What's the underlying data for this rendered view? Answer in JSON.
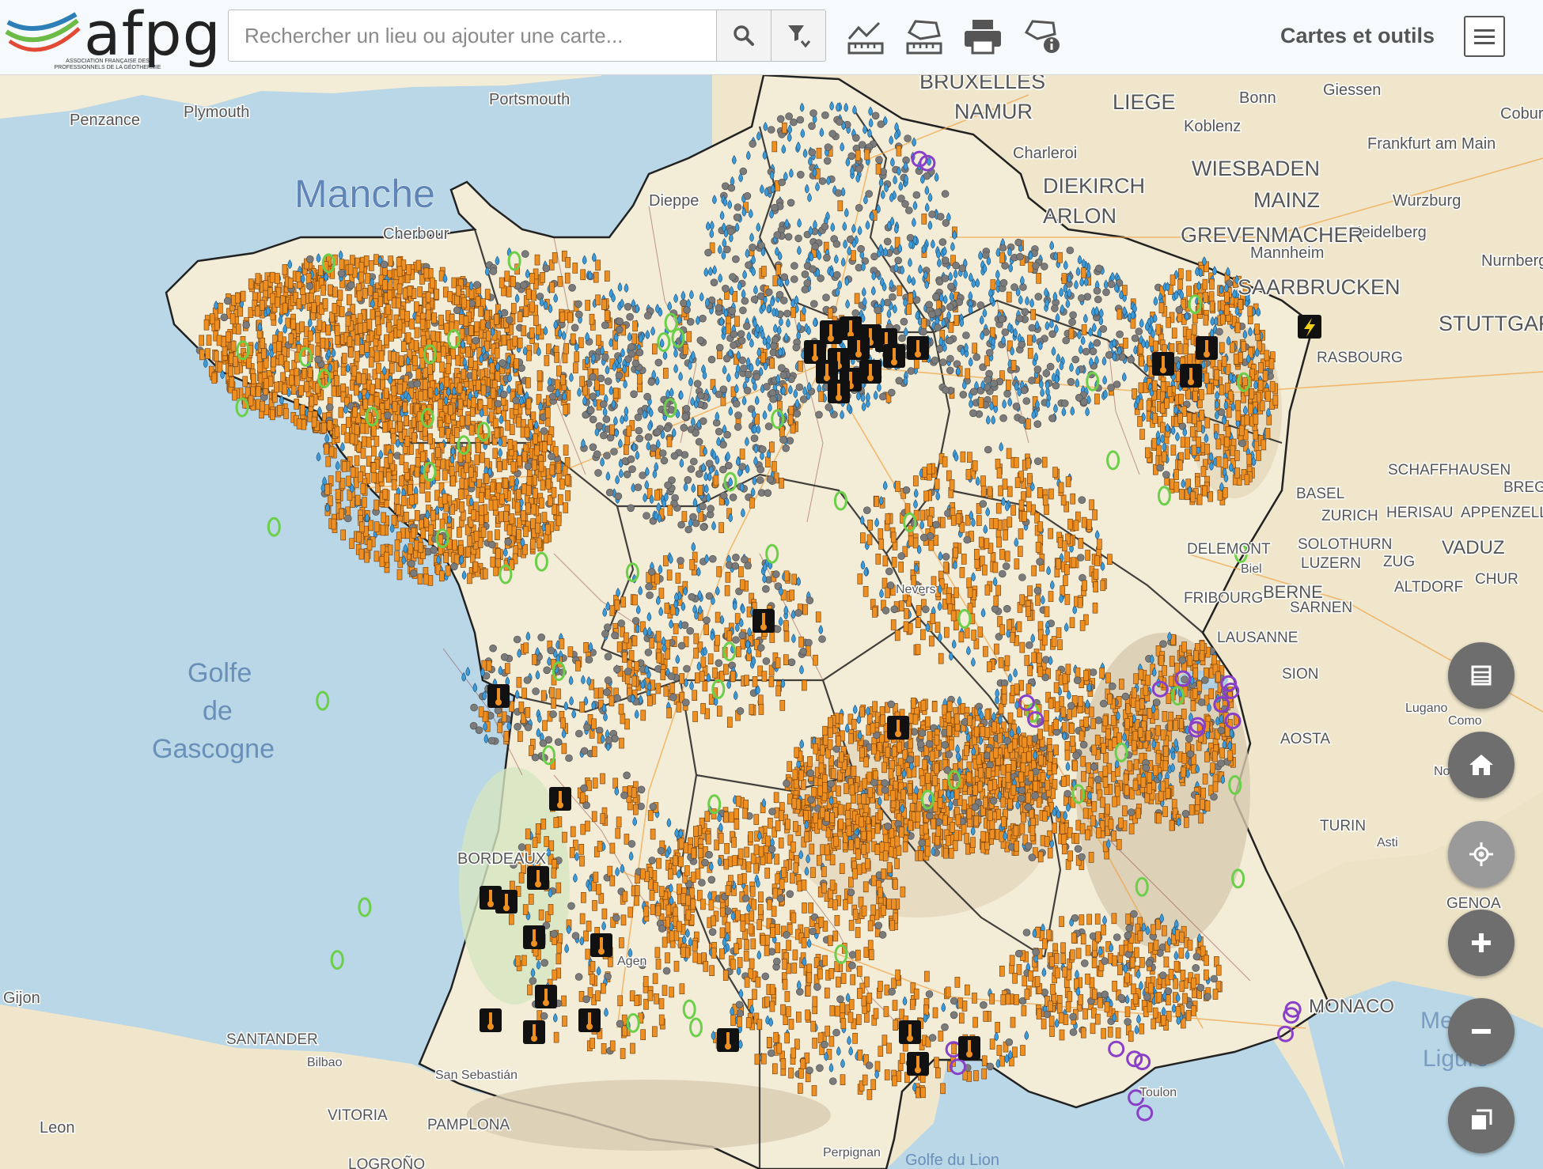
{
  "header": {
    "logo_text": "afpg",
    "logo_subtitle": "ASSOCIATION FRANÇAISE DES PROFESSIONNELS DE LA GÉOTHERMIE",
    "search_placeholder": "Rechercher un lieu ou ajouter une carte...",
    "tools_label": "Cartes et outils"
  },
  "icons": [
    "search-icon",
    "filter-icon",
    "measure-line-icon",
    "measure-area-icon",
    "print-icon",
    "info-icon",
    "menu-icon",
    "table-icon",
    "home-icon",
    "locate-icon",
    "zoom-in-icon",
    "zoom-out-icon",
    "background-layers-icon"
  ],
  "map": {
    "sea_labels": {
      "manche": "Manche",
      "golfe1": "Golfe",
      "golfe2": "de",
      "golfe3": "Gascogne",
      "lion": "Golfe du Lion",
      "ligure1": "Mer",
      "ligure2": "Ligure"
    },
    "cities": {
      "penzance": "Penzance",
      "plymouth": "Plymouth",
      "portsmouth": "Portsmouth",
      "bruxelles": "BRUXELLES",
      "namur": "NAMUR",
      "liege": "LIEGE",
      "bonn": "Bonn",
      "giessen": "Giessen",
      "koblenz": "Koblenz",
      "charleroi": "Charleroi",
      "frankfurt": "Frankfurt am Main",
      "coburg": "Coburg",
      "wiesbaden": "WIESBADEN",
      "mainz": "MAINZ",
      "wurzburg": "Wurzburg",
      "diekirch": "DIEKIRCH",
      "arlon": "ARLON",
      "grevenmacher": "GREVENMACHER",
      "heidelberg": "Heidelberg",
      "mannheim": "Mannheim",
      "nurnberg": "Nurnberg",
      "saarbrucken": "SAARBRUCKEN",
      "stuttgart": "STUTTGART",
      "strasbourg": "RASBOURG",
      "dieppe": "Dieppe",
      "cherbourg": "Cherbour",
      "schaffhausen": "SCHAFFHAUSEN",
      "bregenz": "BREGEN",
      "basel": "BASEL",
      "zurich": "ZURICH",
      "herisau": "HERISAU",
      "appenzell": "APPENZELL",
      "solothurn": "SOLOTHURN",
      "vaduz": "VADUZ",
      "luzern": "LUZERN",
      "zug": "ZUG",
      "chur": "CHUR",
      "bern": "BERNE",
      "altdorf": "ALTDORF",
      "sarnen": "SARNEN",
      "lausanne": "LAUSANNE",
      "sion": "SION",
      "aosta": "AOSTA",
      "lugano": "Lugano",
      "como": "Como",
      "novara": "Novara",
      "turin": "TURIN",
      "asti": "Asti",
      "genoa": "GENOA",
      "monaco": "MONACO",
      "nevers": "Nevers",
      "bordeaux": "BORDEAUX",
      "santander": "SANTANDER",
      "bilbao": "Bilbao",
      "sansebastian": "San Sebastián",
      "vitoria": "VITORIA",
      "pamplona": "PAMPLONA",
      "logrono": "LOGROÑO",
      "leon": "Leon",
      "gijon": "Gijon",
      "toulon": "Toulon",
      "perpignan": "Perpignan",
      "delemont": "DELEMONT",
      "fribourg": "FRIBOURG",
      "biel": "Biel",
      "agen": "Agen"
    }
  },
  "colors": {
    "sea": "#b9d7e6",
    "land": "#f3ecd6",
    "orange_marker": "#ee8f22",
    "blue_marker": "#3c9ad6",
    "gray_marker": "#7b7b7b",
    "green_marker": "#6ccf4a",
    "purple_marker": "#8a3fc9",
    "black_marker": "#111111"
  }
}
